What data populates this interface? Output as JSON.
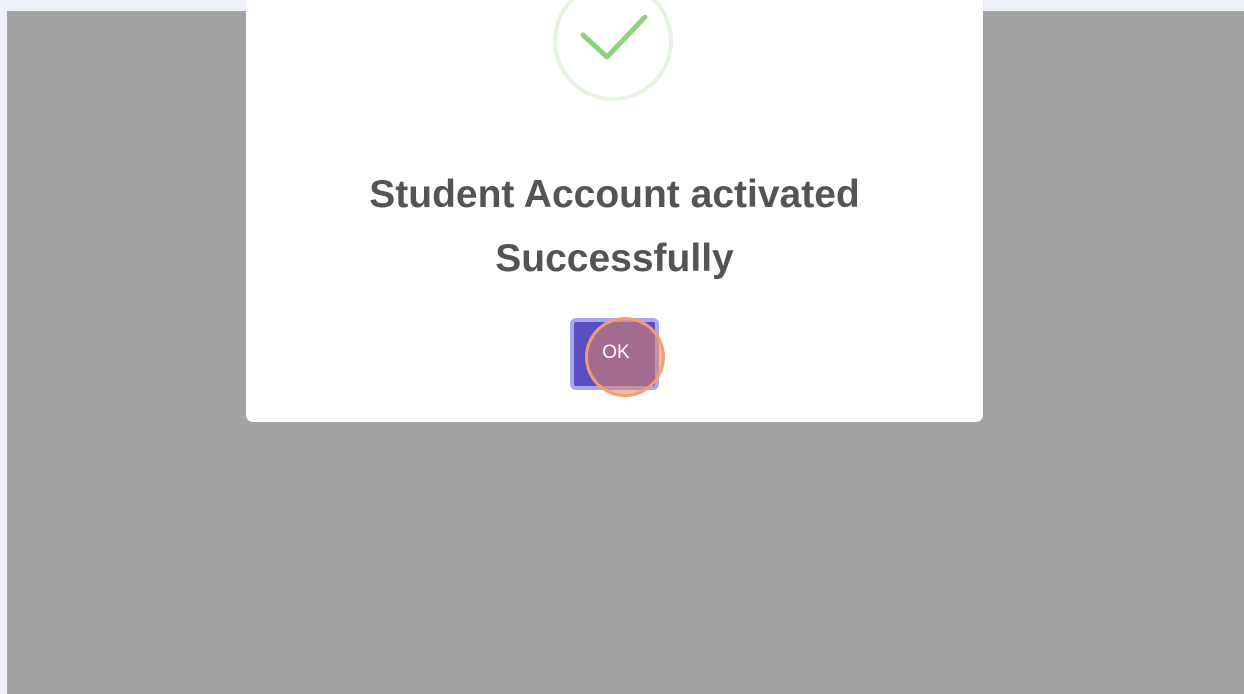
{
  "dialog": {
    "icon": "checkmark-icon",
    "message_line1": "Student Account activated",
    "message_line2": "Successfully",
    "ok_label": "OK"
  },
  "colors": {
    "overlay": "#a3a3a3",
    "dialog_bg": "#ffffff",
    "check_green": "#8fd27e",
    "button_primary": "#5b4fc4",
    "click_marker": "#f4a06e"
  }
}
